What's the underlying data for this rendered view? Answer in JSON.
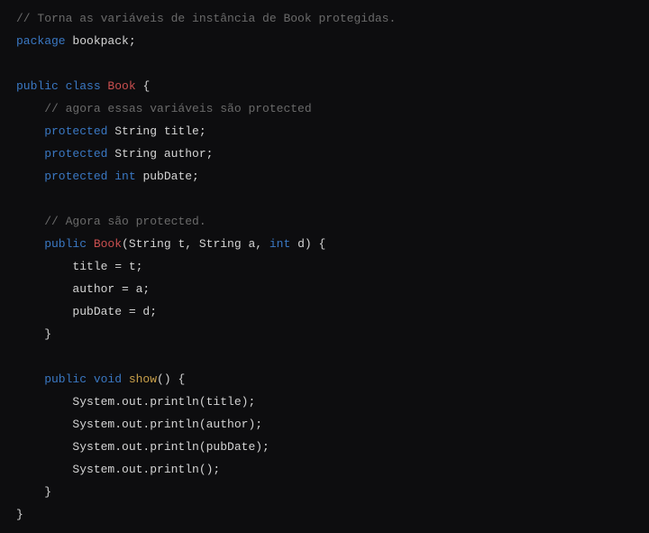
{
  "code": {
    "l1_comment": "// Torna as variáveis de instância de Book protegidas.",
    "l2_kw_package": "package",
    "l2_name": " bookpack;",
    "l4_kw_public": "public",
    "l4_kw_class": " class",
    "l4_classname": " Book",
    "l4_tail": " {",
    "l5_comment": "    // agora essas variáveis são protected",
    "l6_kw": "    protected",
    "l6_rest": " String title;",
    "l7_kw": "    protected",
    "l7_rest": " String author;",
    "l8_kw": "    protected",
    "l8_kw2": " int",
    "l8_rest": " pubDate;",
    "l10_comment": "    // Agora são protected.",
    "l11_kw": "    public",
    "l11_name": " Book",
    "l11_sig1": "(String t, String a, ",
    "l11_kw2": "int",
    "l11_sig2": " d) {",
    "l12": "        title = t;",
    "l13": "        author = a;",
    "l14": "        pubDate = d;",
    "l15": "    }",
    "l17_kw": "    public",
    "l17_kw2": " void",
    "l17_name": " show",
    "l17_tail": "() {",
    "l18": "        System.out.println(title);",
    "l19": "        System.out.println(author);",
    "l20": "        System.out.println(pubDate);",
    "l21": "        System.out.println();",
    "l22": "    }",
    "l23": "}"
  }
}
